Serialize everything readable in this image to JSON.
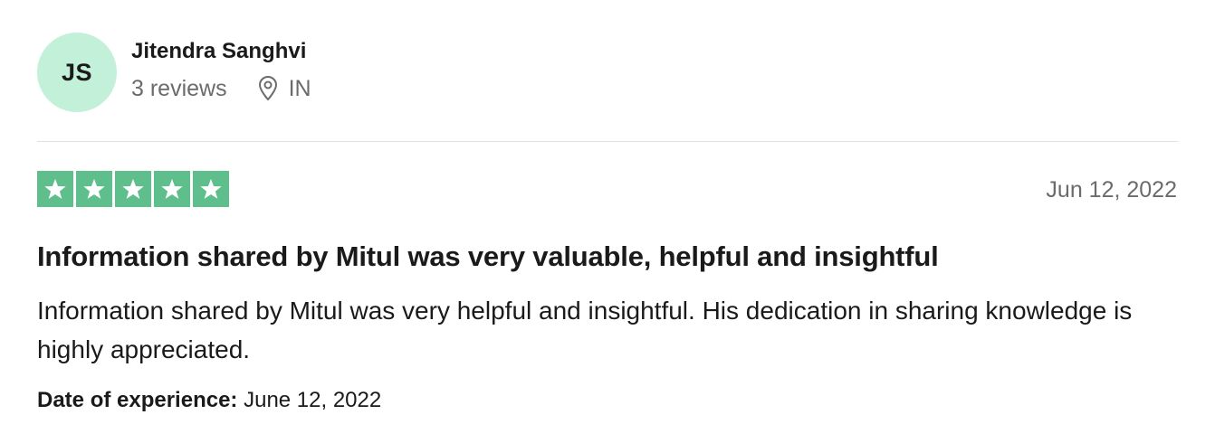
{
  "consumer": {
    "initials": "JS",
    "name": "Jitendra Sanghvi",
    "reviews_count": "3 reviews",
    "location": "IN",
    "avatar_color": "#c2f0d8"
  },
  "review": {
    "rating": 5,
    "rating_max": 5,
    "star_color": "#5ebf8c",
    "date": "Jun 12, 2022",
    "title": "Information shared by Mitul was very valuable, helpful and insightful",
    "text": "Information shared by Mitul was very helpful and insightful. His dedication in sharing knowledge is highly appreciated.",
    "experience_label": "Date of experience:",
    "experience_date": "June 12, 2022"
  },
  "icons": {
    "location": "location-pin-icon",
    "star": "star-icon"
  }
}
